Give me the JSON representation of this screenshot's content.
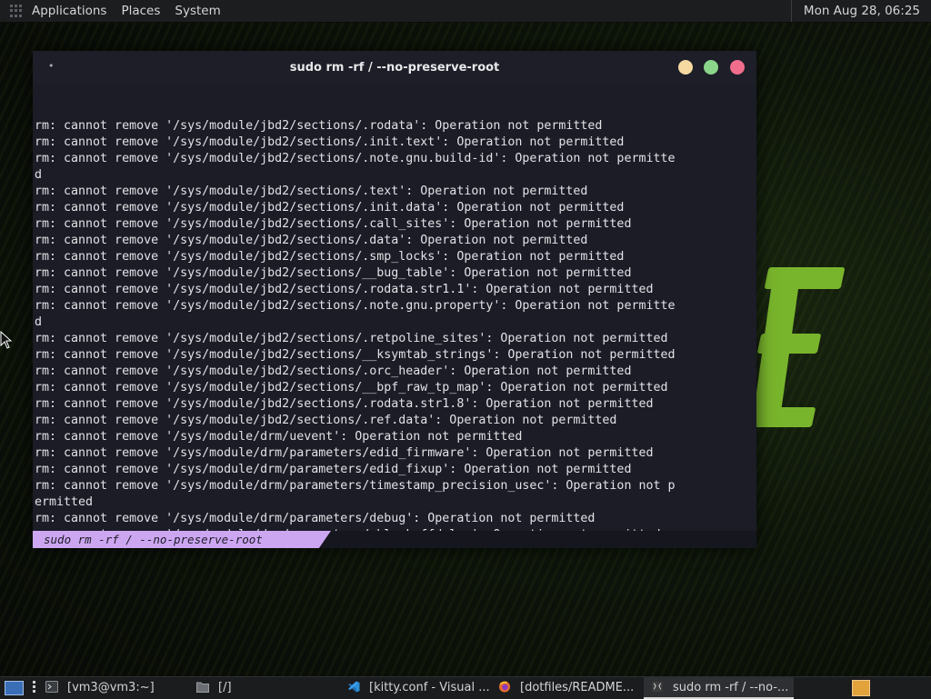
{
  "top_panel": {
    "menus": [
      "Applications",
      "Places",
      "System"
    ],
    "clock": "Mon Aug 28, 06:25"
  },
  "terminal": {
    "title_dot": "•",
    "title": "sudo rm -rf / --no-preserve-root",
    "lines": [
      "rm: cannot remove '/sys/module/jbd2/sections/.rodata': Operation not permitted",
      "rm: cannot remove '/sys/module/jbd2/sections/.init.text': Operation not permitted",
      "rm: cannot remove '/sys/module/jbd2/sections/.note.gnu.build-id': Operation not permitte",
      "d",
      "rm: cannot remove '/sys/module/jbd2/sections/.text': Operation not permitted",
      "rm: cannot remove '/sys/module/jbd2/sections/.init.data': Operation not permitted",
      "rm: cannot remove '/sys/module/jbd2/sections/.call_sites': Operation not permitted",
      "rm: cannot remove '/sys/module/jbd2/sections/.data': Operation not permitted",
      "rm: cannot remove '/sys/module/jbd2/sections/.smp_locks': Operation not permitted",
      "rm: cannot remove '/sys/module/jbd2/sections/__bug_table': Operation not permitted",
      "rm: cannot remove '/sys/module/jbd2/sections/.rodata.str1.1': Operation not permitted",
      "rm: cannot remove '/sys/module/jbd2/sections/.note.gnu.property': Operation not permitte",
      "d",
      "rm: cannot remove '/sys/module/jbd2/sections/.retpoline_sites': Operation not permitted",
      "rm: cannot remove '/sys/module/jbd2/sections/__ksymtab_strings': Operation not permitted",
      "rm: cannot remove '/sys/module/jbd2/sections/.orc_header': Operation not permitted",
      "rm: cannot remove '/sys/module/jbd2/sections/__bpf_raw_tp_map': Operation not permitted",
      "rm: cannot remove '/sys/module/jbd2/sections/.rodata.str1.8': Operation not permitted",
      "rm: cannot remove '/sys/module/jbd2/sections/.ref.data': Operation not permitted",
      "rm: cannot remove '/sys/module/drm/uevent': Operation not permitted",
      "rm: cannot remove '/sys/module/drm/parameters/edid_firmware': Operation not permitted",
      "rm: cannot remove '/sys/module/drm/parameters/edid_fixup': Operation not permitted",
      "rm: cannot remove '/sys/module/drm/parameters/timestamp_precision_usec': Operation not p",
      "ermitted",
      "rm: cannot remove '/sys/module/drm/parameters/debug': Operation not permitted",
      "rm: cannot remove '/sys/module/drm/parameters/vblankoffdelay': Operation not permitted"
    ],
    "tab_label": "sudo rm -rf / --no-preserve-root"
  },
  "taskbar": {
    "tasks": [
      {
        "label": "[vm3@vm3:~]",
        "icon": "terminal-icon"
      },
      {
        "label": "[/]",
        "icon": "folder-icon"
      },
      {
        "label": "[kitty.conf - Visual ...",
        "icon": "vscode-icon"
      },
      {
        "label": "[dotfiles/README...",
        "icon": "firefox-icon"
      },
      {
        "label": "sudo rm -rf / --no-...",
        "icon": "kitty-icon"
      }
    ]
  },
  "colors": {
    "terminal_bg": "#1b1c26",
    "tab_accent": "#cda6f2",
    "wallpaper_accent": "#79b52c",
    "btn_min": "#f5d9a0",
    "btn_max": "#8ad58a",
    "btn_close": "#f06e8c"
  }
}
